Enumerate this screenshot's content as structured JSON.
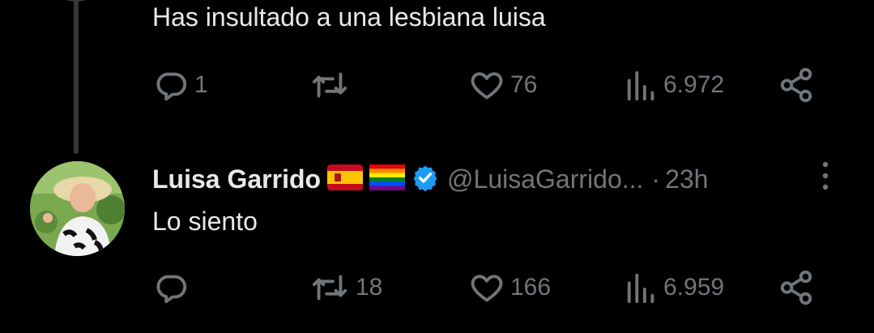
{
  "previous_reply": {
    "text": "Has insultado a una lesbiana luisa",
    "stats": {
      "replies": "1",
      "reposts": "",
      "likes": "76",
      "views": "6.972"
    }
  },
  "tweet": {
    "author_name": "Luisa Garrido",
    "flags": [
      "spain-flag",
      "rainbow-flag"
    ],
    "verified": true,
    "handle": "@LuisaGarrido...",
    "separator": "·",
    "time": "23h",
    "text": "Lo siento",
    "stats": {
      "replies": "",
      "reposts": "18",
      "likes": "166",
      "views": "6.959"
    }
  },
  "colors": {
    "background": "#000000",
    "text": "#e7e9ea",
    "muted": "#71767b",
    "verified_blue": "#1d9bf0",
    "thread_line": "#333639"
  },
  "icons": [
    "reply-icon",
    "repost-icon",
    "like-icon",
    "views-icon",
    "share-icon",
    "verified-icon",
    "more-icon"
  ]
}
